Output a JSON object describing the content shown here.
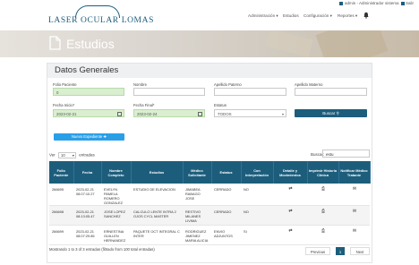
{
  "brand": {
    "name": "LASER OCULAR LOMAS"
  },
  "user_bar": {
    "user": "admin - Administrador sistema",
    "logout": "Salir"
  },
  "nav": {
    "items": [
      "Administración",
      "Estudios",
      "Configuración",
      "Reportes"
    ]
  },
  "hero": {
    "title": "Estudios"
  },
  "card": {
    "title": "Datos Generales"
  },
  "form": {
    "folio_paciente": {
      "label": "Folio Paciente",
      "value": "0"
    },
    "nombre": {
      "label": "Nombre",
      "value": ""
    },
    "apellido_paterno": {
      "label": "Apellido Paterno",
      "value": ""
    },
    "apellido_materno": {
      "label": "Apellido Materno",
      "value": ""
    },
    "fecha_inicio": {
      "label": "Fecha Inicio*",
      "value": "2023-02-21"
    },
    "fecha_final": {
      "label": "Fecha Final*",
      "value": "2023-02-24"
    },
    "estatus": {
      "label": "Estatus",
      "value": "TODOS"
    },
    "buscar_label": "Buscar",
    "nuevo_label": "Nuevo Expediente"
  },
  "table_controls": {
    "ver_label": "Ver",
    "page_size": "10",
    "entries_label": "entradas",
    "search_label": "Buscar:",
    "search_value": "estu"
  },
  "table": {
    "headers": [
      "Folio Paciente",
      "Fecha",
      "Nombre Completo",
      "Estudios",
      "Médico Solicitante",
      "Estatus",
      "Con Interpretación",
      "Detalle y Movimientos",
      "Imprimir Historia Clínica",
      "Notificar Médico Tratante"
    ],
    "rows": [
      {
        "folio": "266695",
        "fecha": "2023-02-21 08:07:10.27",
        "nombre": "EVELYN PAMELA ROMERO GONZALEZ",
        "estudios": "ESTUDIO DE ELEVACION",
        "medico": "JIMABEA RABAGO JOSE",
        "estatus": "CERRADO",
        "interpretacion": "NO"
      },
      {
        "folio": "266698",
        "fecha": "2023-02-21 08:13:05.47",
        "nombre": "JOSE LOPEZ SANCHEZ",
        "estudios": "CALCULO LENTE INTRA 2 OJOS CYCL MASTER",
        "medico": "RESTIVO MILANES LIVIMA",
        "estatus": "CERRADO",
        "interpretacion": "NO"
      },
      {
        "folio": "266699",
        "fecha": "2023-02-21 08:07:29.85",
        "nombre": "ERNESTINA GUILLEN HERNANDEZ",
        "estudios": "PAQUETE OCT INTEGRAL C INTER",
        "medico": "RODRIGUEZ JIMENEZ MARIA ALICIA",
        "estatus": "ENVIO ADJUNTOS",
        "interpretacion": "SI"
      }
    ]
  },
  "footer": {
    "info": "Mostrando 1 to 3 of 3 entradas (filtrado from 100 total entradas)"
  },
  "pagination": {
    "prev": "Previous",
    "current": "1",
    "next": "Next"
  },
  "colors": {
    "primary": "#1d5d7c",
    "accent": "#2a9fe8",
    "highlight": "#d9efd0"
  },
  "icons": {
    "detalle": "refresh-icon",
    "imprimir": "print-icon",
    "notificar": "mail-icon",
    "notifications": "bell-icon",
    "document": "document-icon"
  }
}
